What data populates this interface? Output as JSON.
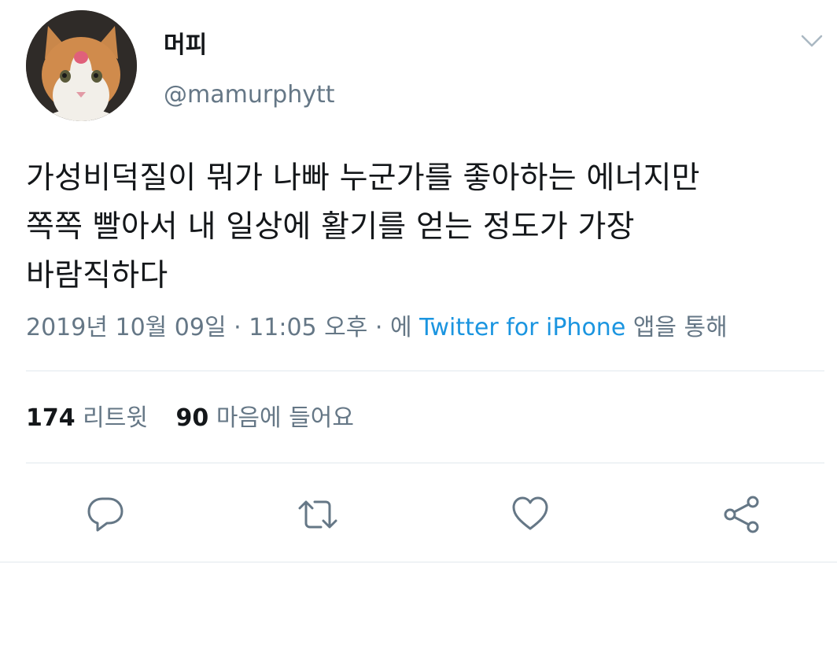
{
  "author": {
    "display_name": "머피",
    "handle": "@mamurphytt",
    "avatar_icon": "cat-avatar-icon"
  },
  "tweet": {
    "text_lines": [
      "가성비덕질이 뭐가 나빠 누군가를 좋아하는 에너지만",
      "쪽쪽 빨아서 내 일상에 활기를 얻는 정도가 가장",
      "바람직하다"
    ]
  },
  "meta": {
    "date": "2019년 10월 09일",
    "separator1": " · ",
    "time": "11:05 오후",
    "separator2": " · ",
    "via_prefix": "에 ",
    "source": "Twitter for iPhone",
    "via_suffix": " 앱을 통해"
  },
  "stats": {
    "retweet_count": "174",
    "retweet_label": "리트윗",
    "like_count": "90",
    "like_label": "마음에 들어요"
  },
  "actions": {
    "reply_icon": "reply-icon",
    "retweet_icon": "retweet-icon",
    "like_icon": "heart-icon",
    "share_icon": "share-icon"
  },
  "colors": {
    "text": "#14171a",
    "secondary": "#657786",
    "link": "#1b95e0",
    "divider": "#e1e8ed"
  }
}
